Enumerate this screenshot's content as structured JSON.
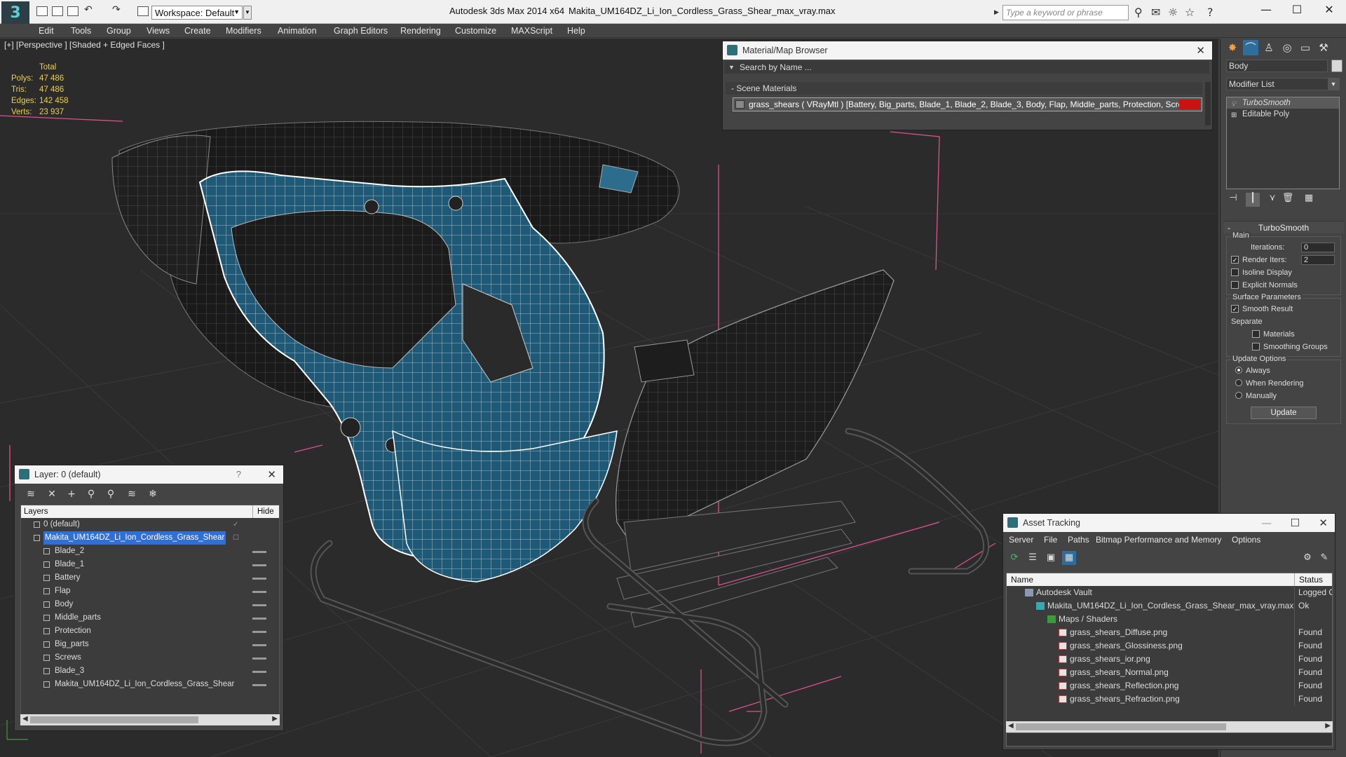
{
  "titlebar": {
    "workspace": "Workspace: Default",
    "app_title": "Autodesk 3ds Max  2014 x64",
    "file_title": "Makita_UM164DZ_Li_Ion_Cordless_Grass_Shear_max_vray.max",
    "search_placeholder": "Type a keyword or phrase"
  },
  "menu": [
    "Edit",
    "Tools",
    "Group",
    "Views",
    "Create",
    "Modifiers",
    "Animation",
    "Graph Editors",
    "Rendering",
    "Customize",
    "MAXScript",
    "Help"
  ],
  "viewport": {
    "label": "[+] [Perspective ] [Shaded + Edged Faces ]",
    "stats": {
      "total_label": "Total",
      "rows": [
        {
          "label": "Polys:",
          "value": "47 486"
        },
        {
          "label": "Tris:",
          "value": "47 486"
        },
        {
          "label": "Edges:",
          "value": "142 458"
        },
        {
          "label": "Verts:",
          "value": "23 937"
        }
      ]
    }
  },
  "material_browser": {
    "title": "Material/Map Browser",
    "search": "Search by Name ...",
    "section": "- Scene Materials",
    "material": "grass_shears  ( VRayMtl ) [Battery, Big_parts, Blade_1, Blade_2, Blade_3, Body, Flap, Middle_parts, Protection, Screws]"
  },
  "command_panel": {
    "object_name": "Body",
    "modifier_list": "Modifier List",
    "stack": [
      "TurboSmooth",
      "Editable Poly"
    ],
    "rollout": "TurboSmooth",
    "main_group": "Main",
    "iterations_label": "Iterations:",
    "iterations_value": "0",
    "render_iters_label": "Render Iters:",
    "render_iters_value": "2",
    "isoline": "Isoline Display",
    "explicit": "Explicit Normals",
    "surface_group": "Surface Parameters",
    "smooth_result": "Smooth Result",
    "separate": "Separate",
    "materials": "Materials",
    "smoothing_groups": "Smoothing Groups",
    "update_group": "Update Options",
    "always": "Always",
    "when_rendering": "When Rendering",
    "manually": "Manually",
    "update_btn": "Update"
  },
  "layer_panel": {
    "title": "Layer: 0 (default)",
    "help": "?",
    "col_layers": "Layers",
    "col_hide": "Hide",
    "rows": [
      {
        "name": "0 (default)",
        "level": 0
      },
      {
        "name": "Makita_UM164DZ_Li_Ion_Cordless_Grass_Shear",
        "level": 0
      },
      {
        "name": "Blade_2",
        "level": 1
      },
      {
        "name": "Blade_1",
        "level": 1
      },
      {
        "name": "Battery",
        "level": 1
      },
      {
        "name": "Flap",
        "level": 1
      },
      {
        "name": "Body",
        "level": 1
      },
      {
        "name": "Middle_parts",
        "level": 1
      },
      {
        "name": "Protection",
        "level": 1
      },
      {
        "name": "Big_parts",
        "level": 1
      },
      {
        "name": "Screws",
        "level": 1
      },
      {
        "name": "Blade_3",
        "level": 1
      },
      {
        "name": "Makita_UM164DZ_Li_Ion_Cordless_Grass_Shear",
        "level": 1
      }
    ]
  },
  "asset_panel": {
    "title": "Asset Tracking",
    "menu": [
      "Server",
      "File",
      "Paths",
      "Bitmap Performance and Memory",
      "Options"
    ],
    "col_name": "Name",
    "col_status": "Status",
    "rows": [
      {
        "name": "Autodesk Vault",
        "status": "Logged O",
        "indent": 1
      },
      {
        "name": "Makita_UM164DZ_Li_Ion_Cordless_Grass_Shear_max_vray.max",
        "status": "Ok",
        "indent": 2
      },
      {
        "name": "Maps / Shaders",
        "status": "",
        "indent": 3
      },
      {
        "name": "grass_shears_Diffuse.png",
        "status": "Found",
        "indent": 4
      },
      {
        "name": "grass_shears_Glossiness.png",
        "status": "Found",
        "indent": 4
      },
      {
        "name": "grass_shears_ior.png",
        "status": "Found",
        "indent": 4
      },
      {
        "name": "grass_shears_Normal.png",
        "status": "Found",
        "indent": 4
      },
      {
        "name": "grass_shears_Reflection.png",
        "status": "Found",
        "indent": 4
      },
      {
        "name": "grass_shears_Refraction.png",
        "status": "Found",
        "indent": 4
      }
    ]
  },
  "colors": {
    "viewport_bg": "#2b2b2b",
    "model_blue": "#1e5a78",
    "stats_yellow": "#f0d040",
    "bbox_pink": "#e0508a",
    "selection_blue": "#2f6fd6",
    "material_red": "#cc1111"
  }
}
